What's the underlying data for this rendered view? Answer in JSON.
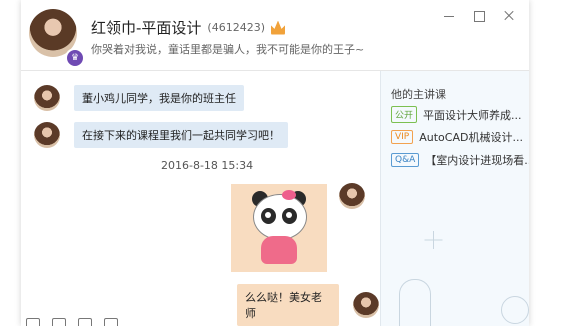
{
  "header": {
    "title": "红领巾-平面设计",
    "qq_number": "(4612423)",
    "signature": "你哭着对我说，童话里都是骗人，我不可能是你的王子~"
  },
  "chat": {
    "messages": [
      {
        "side": "left",
        "text": "董小鸡儿同学，我是你的班主任"
      },
      {
        "side": "left",
        "text": "在接下来的课程里我们一起共同学习吧！"
      },
      {
        "side": "right",
        "text": "么么哒！美女老师"
      }
    ],
    "timestamp": "2016-8-18 15:34"
  },
  "sidebar": {
    "title": "他的主讲课",
    "courses": [
      {
        "tag": "公开",
        "label": "平面设计大师养成..."
      },
      {
        "tag": "VIP",
        "label": "AutoCAD机械设计..."
      },
      {
        "tag": "Q&A",
        "label": "【室内设计进现场看..."
      }
    ]
  },
  "colors": {
    "bubble_bg": "#dfeaf5",
    "sticker_bg": "#f8dcc0",
    "sidebar_bg": "#f4f9fd",
    "vip_orange": "#ec8a1f",
    "open_green": "#60a53d",
    "qa_blue": "#3b84c4"
  },
  "icons": [
    "crown-icon",
    "minimize-icon",
    "maximize-icon",
    "close-icon",
    "emoji-icon",
    "screenshot-icon",
    "folder-icon",
    "image-icon"
  ]
}
